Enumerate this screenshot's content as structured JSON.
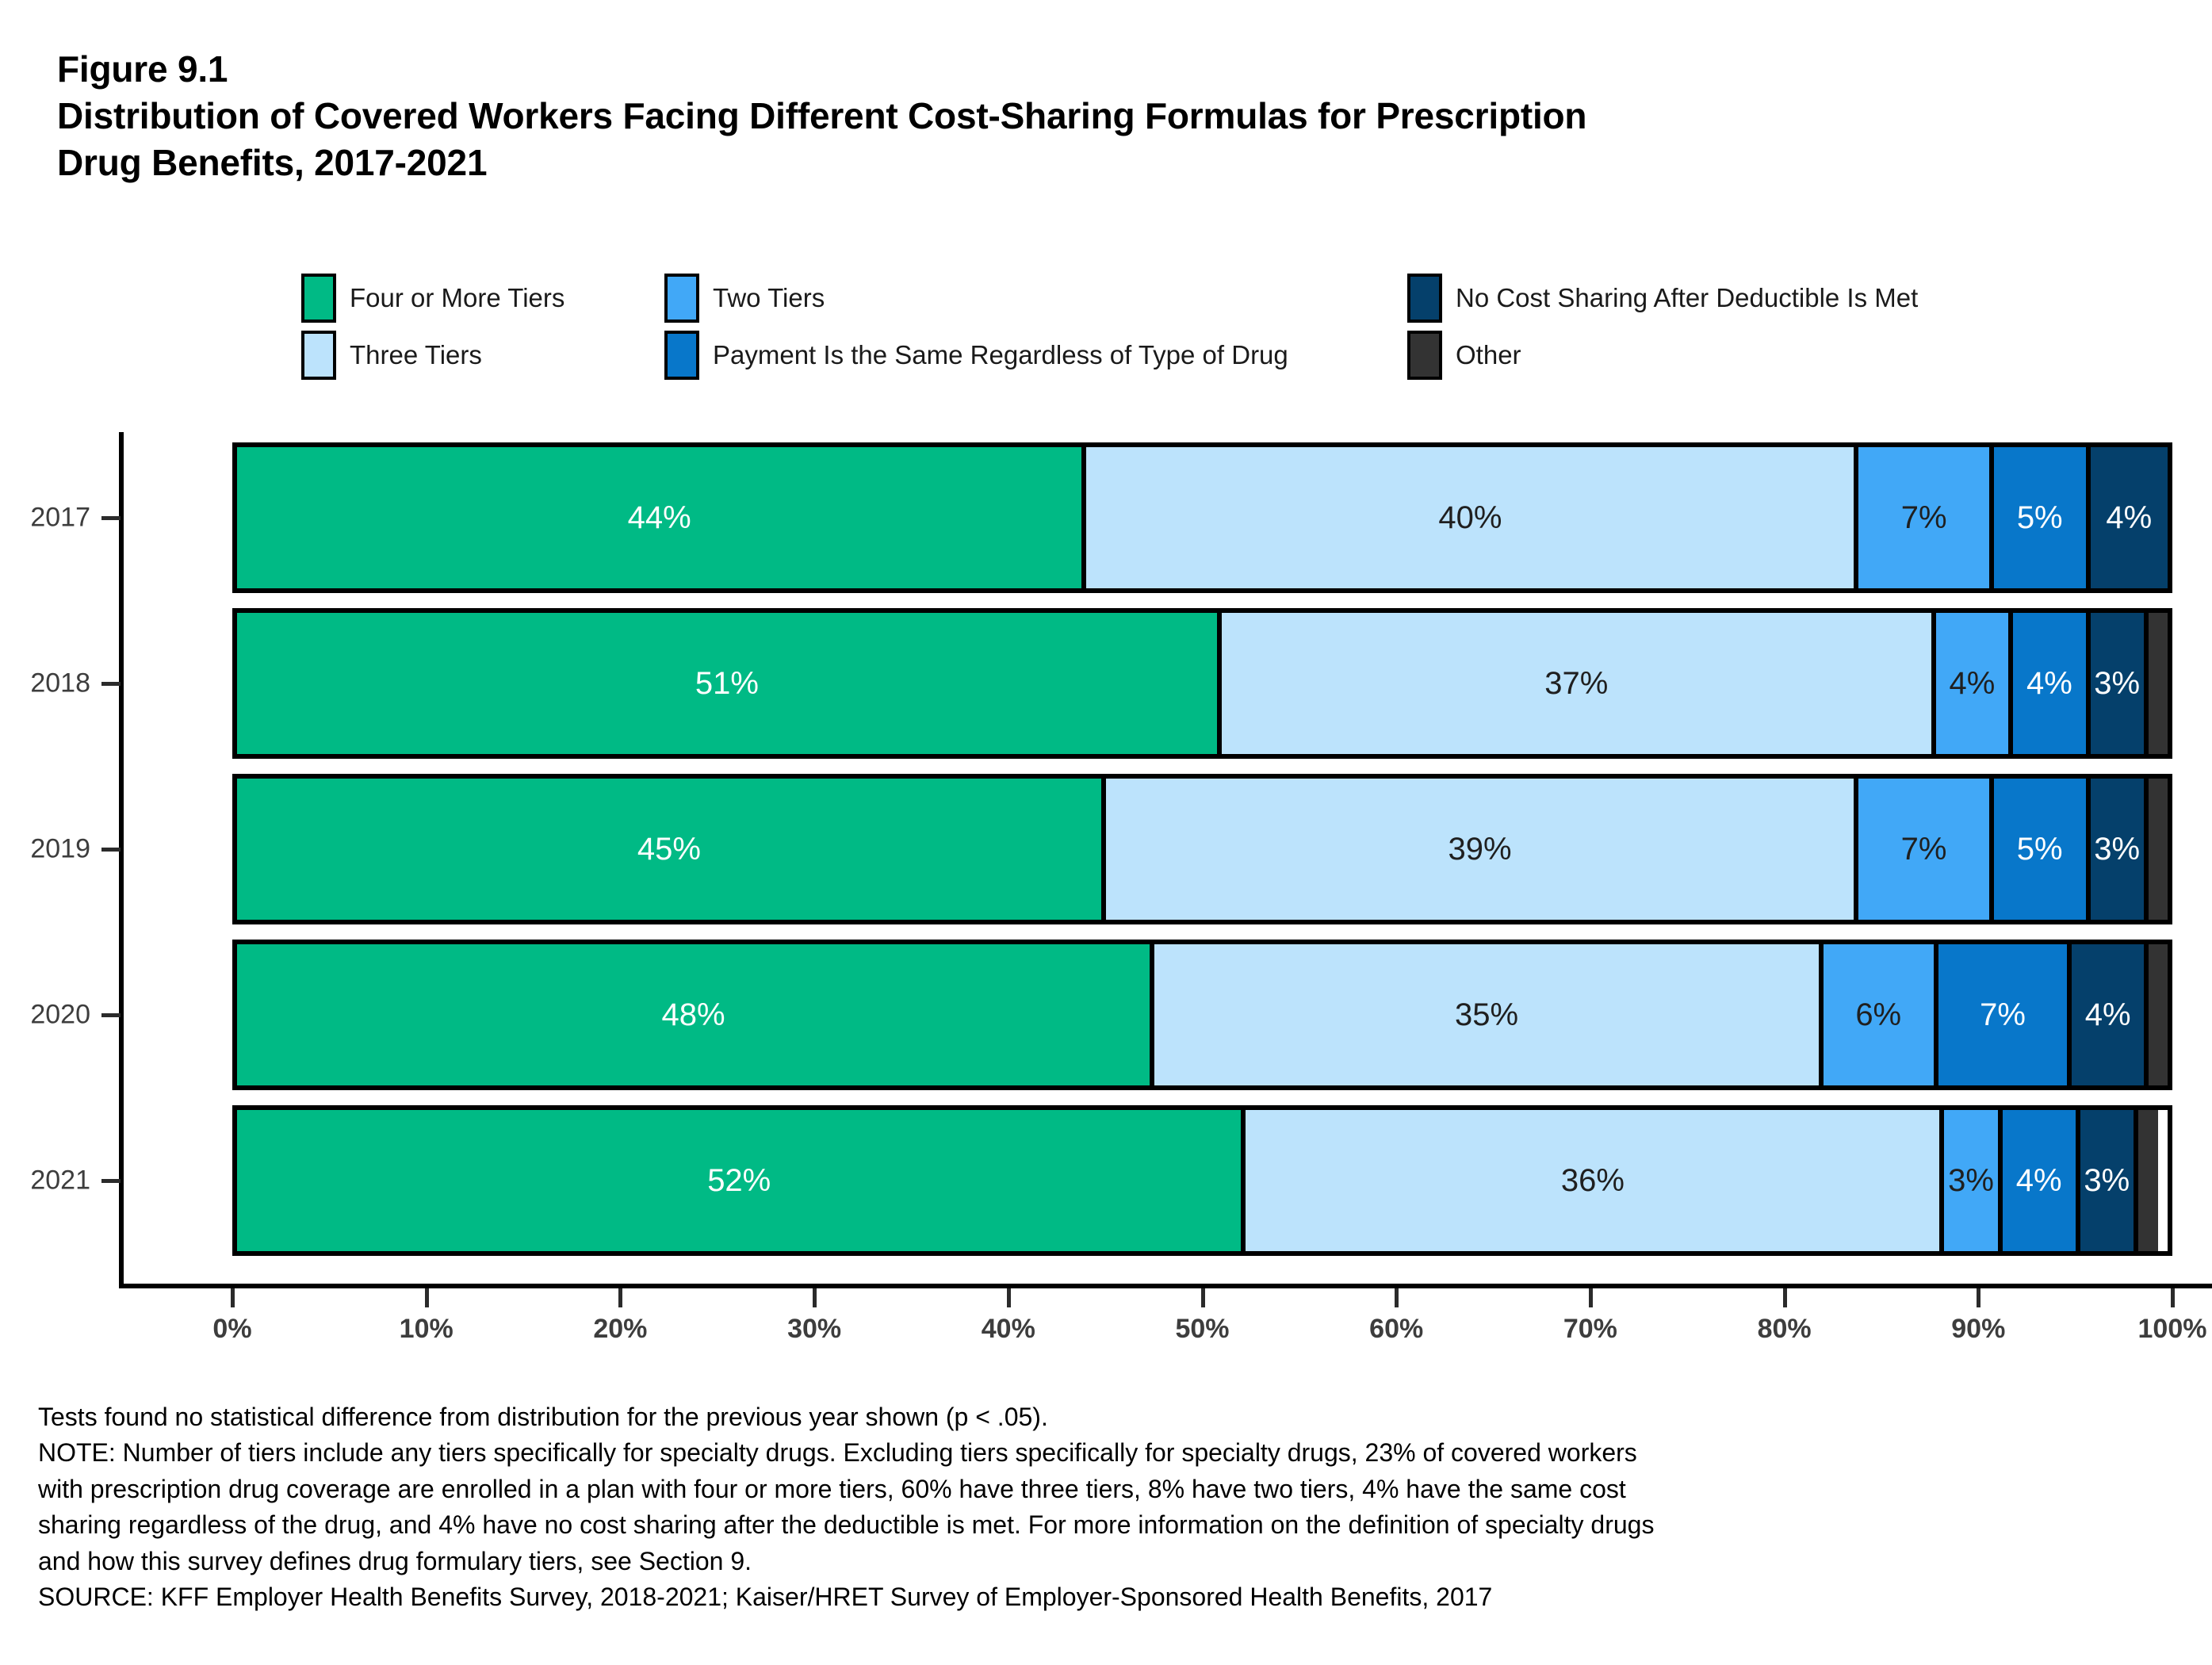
{
  "figure": {
    "number": "Figure 9.1",
    "title_line1": "Distribution of Covered Workers Facing Different Cost-Sharing Formulas for Prescription",
    "title_line2": "Drug Benefits, 2017-2021"
  },
  "legend": {
    "items": [
      {
        "label": "Four or More Tiers",
        "color": "#00BA85"
      },
      {
        "label": "Three Tiers",
        "color": "#BCE3FC"
      },
      {
        "label": "Two Tiers",
        "color": "#41A8F7"
      },
      {
        "label": "Payment Is the Same Regardless of Type of Drug",
        "color": "#0877CA"
      },
      {
        "label": "No Cost Sharing After Deductible Is Met",
        "color": "#05406B"
      },
      {
        "label": "Other",
        "color": "#333333"
      }
    ]
  },
  "notes": {
    "lines": [
      "Tests found no statistical difference from distribution for the previous year shown (p < .05).",
      "NOTE: Number of tiers include any tiers specifically for specialty drugs. Excluding tiers specifically for specialty drugs, 23% of covered workers",
      "with prescription drug coverage are enrolled in a plan with four or more tiers, 60% have three tiers, 8% have two tiers, 4% have the same cost",
      "sharing regardless of the drug, and 4% have no cost sharing after the deductible is met. For more information on the definition of specialty drugs",
      "and how this survey defines drug formulary tiers, see Section 9.",
      "SOURCE: KFF Employer Health Benefits Survey, 2018-2021; Kaiser/HRET Survey of Employer-Sponsored Health Benefits, 2017"
    ]
  },
  "chart_data": {
    "type": "bar",
    "orientation": "horizontal",
    "stacked": true,
    "stack_mode": "percent",
    "title": "Distribution of Covered Workers Facing Different Cost-Sharing Formulas for Prescription Drug Benefits, 2017-2021",
    "xlabel": "",
    "ylabel": "",
    "xlim": [
      0,
      100
    ],
    "xticks": [
      0,
      10,
      20,
      30,
      40,
      50,
      60,
      70,
      80,
      90,
      100
    ],
    "xtick_labels": [
      "0%",
      "10%",
      "20%",
      "30%",
      "40%",
      "50%",
      "60%",
      "70%",
      "80%",
      "90%",
      "100%"
    ],
    "grid": false,
    "legend_position": "top",
    "categories": [
      "2017",
      "2018",
      "2019",
      "2020",
      "2021"
    ],
    "series": [
      {
        "name": "Four or More Tiers",
        "color": "#00BA85",
        "values": [
          44,
          51,
          45,
          48,
          52
        ],
        "labels": [
          "44%",
          "51%",
          "45%",
          "48%",
          "52%"
        ],
        "label_color": "#ffffff"
      },
      {
        "name": "Three Tiers",
        "color": "#BCE3FC",
        "values": [
          40,
          37,
          39,
          35,
          36
        ],
        "labels": [
          "40%",
          "37%",
          "39%",
          "35%",
          "36%"
        ],
        "label_color": "#1f1f1f"
      },
      {
        "name": "Two Tiers",
        "color": "#41A8F7",
        "values": [
          7,
          4,
          7,
          6,
          3
        ],
        "labels": [
          "7%",
          "4%",
          "7%",
          "6%",
          "3%"
        ],
        "label_color": "#1f1f1f"
      },
      {
        "name": "Payment Is the Same Regardless of Type of Drug",
        "color": "#0877CA",
        "values": [
          5,
          4,
          5,
          7,
          4
        ],
        "labels": [
          "5%",
          "4%",
          "5%",
          "7%",
          "4%"
        ],
        "label_color": "#ffffff"
      },
      {
        "name": "No Cost Sharing After Deductible Is Met",
        "color": "#05406B",
        "values": [
          4,
          3,
          3,
          4,
          3
        ],
        "labels": [
          "4%",
          "3%",
          "3%",
          "4%",
          "3%"
        ],
        "label_color": "#ffffff"
      },
      {
        "name": "Other",
        "color": "#333333",
        "values": [
          0,
          1,
          1,
          1,
          1
        ],
        "labels": [
          "",
          "",
          "",
          "",
          ""
        ],
        "label_color": "#ffffff"
      }
    ]
  }
}
